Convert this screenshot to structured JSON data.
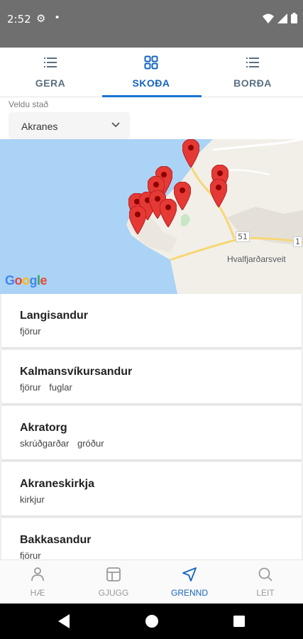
{
  "status": {
    "time": "2:52",
    "icons": [
      "gear-icon",
      "dot-icon",
      "wifi-icon",
      "signal-icon",
      "battery-icon"
    ]
  },
  "tabs": [
    {
      "label": "GERA",
      "icon": "list-icon",
      "active": false
    },
    {
      "label": "SKOÐA",
      "icon": "grid-icon",
      "active": true
    },
    {
      "label": "BORÐA",
      "icon": "list-icon",
      "active": false
    }
  ],
  "location": {
    "label": "Veldu stað",
    "value": "Akranes"
  },
  "map": {
    "place_label": "Hvalfjarðarsveit",
    "road_1": "51",
    "road_2": "1",
    "attribution": "Google"
  },
  "places": [
    {
      "name": "Langisandur",
      "tags": [
        "fjörur"
      ]
    },
    {
      "name": "Kalmansvíkursandur",
      "tags": [
        "fjörur",
        "fuglar"
      ]
    },
    {
      "name": "Akratorg",
      "tags": [
        "skrúðgarðar",
        "gróður"
      ]
    },
    {
      "name": "Akraneskirkja",
      "tags": [
        "kirkjur"
      ]
    },
    {
      "name": "Bakkasandur",
      "tags": [
        "fjörur"
      ]
    }
  ],
  "bottom_nav": [
    {
      "label": "HÆ",
      "icon": "person-icon",
      "active": false
    },
    {
      "label": "GJUGG",
      "icon": "layout-icon",
      "active": false
    },
    {
      "label": "GRENND",
      "icon": "navigation-arrow-icon",
      "active": true
    },
    {
      "label": "LEIT",
      "icon": "search-icon",
      "active": false
    }
  ],
  "colors": {
    "accent": "#1565c0",
    "pin": "#e53935",
    "map_water": "#aad3f5",
    "map_land": "#f2efe9"
  }
}
